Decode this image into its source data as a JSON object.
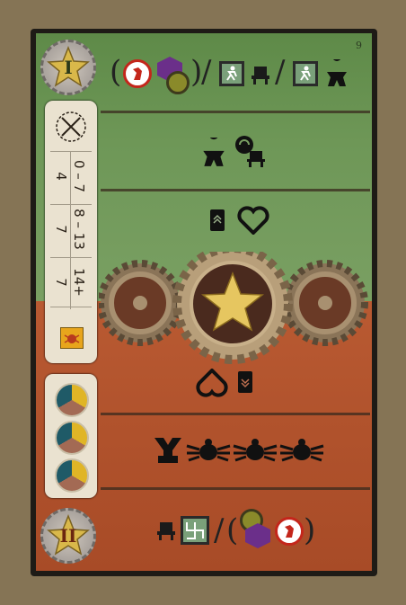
{
  "era_top": "I",
  "era_bottom": "II",
  "card_number": "9",
  "scoreboard": {
    "rows": [
      {
        "range": "0 – 7",
        "points": "4"
      },
      {
        "range": "8 – 13",
        "points": "7"
      },
      {
        "range": "14+",
        "points": "7"
      }
    ]
  },
  "top_row_separator_1": "/",
  "top_row_separator_2": "/",
  "bottom_row_separator": "/",
  "paren_open": "(",
  "paren_close": ")",
  "colors": {
    "green": "#6e9757",
    "orange": "#b0522c",
    "panel": "#eae2d0",
    "gold": "#d9b84a"
  },
  "icons": {
    "top_row": [
      "red-figure-token-icon",
      "purple-city-token-icon",
      "gear-coin-icon",
      "runner-tile-icon",
      "robot-icon",
      "runner-tile-icon",
      "meeple-icon"
    ],
    "second_row": [
      "meeple-icon",
      "robot-cycle-icon"
    ],
    "above_center": [
      "card-up-icon",
      "heart-icon"
    ],
    "below_center": [
      "heart-down-icon",
      "card-down-icon"
    ],
    "lower_row": [
      "y-figure-icon",
      "bug-icon",
      "bug-icon",
      "bug-icon"
    ],
    "bottom_row": [
      "robot-icon",
      "swirl-tile-icon",
      "gear-coin-icon",
      "purple-city-token-icon",
      "red-figure-token-icon"
    ]
  }
}
